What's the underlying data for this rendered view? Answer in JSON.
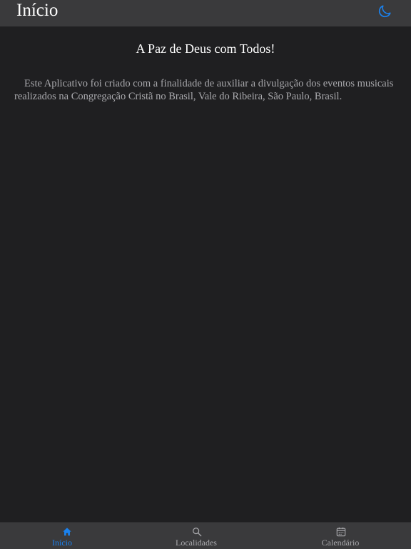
{
  "header": {
    "title": "Início",
    "theme_icon": "moon-icon",
    "accent_color": "#1a82f0"
  },
  "main": {
    "heading": "A Paz de Deus com Todos!",
    "paragraph": "Este Aplicativo foi criado com a finalidade de auxiliar a divulgação dos eventos musicais realizados na Congregação Cristã no Brasil, Vale do Ribeira, São Paulo, Brasil."
  },
  "tabbar": {
    "tabs": [
      {
        "label": "Início",
        "icon": "home-icon",
        "active": true
      },
      {
        "label": "Localidades",
        "icon": "search-icon",
        "active": false
      },
      {
        "label": "Calendário",
        "icon": "calendar-icon",
        "active": false
      }
    ]
  }
}
